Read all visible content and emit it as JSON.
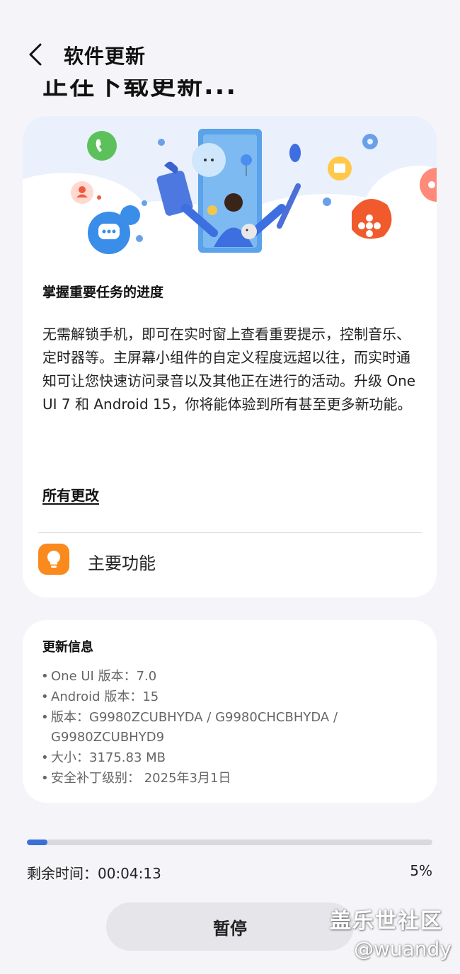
{
  "header": {
    "title": "软件更新",
    "subtitle": "正在下载更新..."
  },
  "card": {
    "heading": "掌握重要任务的进度",
    "body": "无需解锁手机，即可在实时窗上查看重要提示，控制音乐、定时器等。主屏幕小组件的自定义程度远超以往，而实时通知可让您快速访问录音以及其他正在进行的活动。升级 One UI 7 和 Android 15，你将能体验到所有甚至更多新功能。",
    "all_changes": "所有更改",
    "feature_label": "主要功能"
  },
  "update_info": {
    "title": "更新信息",
    "items": [
      "One UI 版本：7.0",
      "Android 版本：15",
      "版本：G9980ZCUBHYDA / G9980CHCBHYDA / G9980ZCUBHYD9",
      "大小：3175.83 MB",
      "安全补丁级别： 2025年3月1日"
    ]
  },
  "progress": {
    "value": 0.05,
    "remaining_label": "剩余时间：00:04:13",
    "percent_label": "5%"
  },
  "pause_button": "暂停",
  "watermark": {
    "line1": "盖乐世社区",
    "line2": "@wuandy"
  },
  "colors": {
    "accent": "#3b6fd8",
    "feature_icon": "#fb8a1e",
    "background": "#f5f5f9"
  }
}
